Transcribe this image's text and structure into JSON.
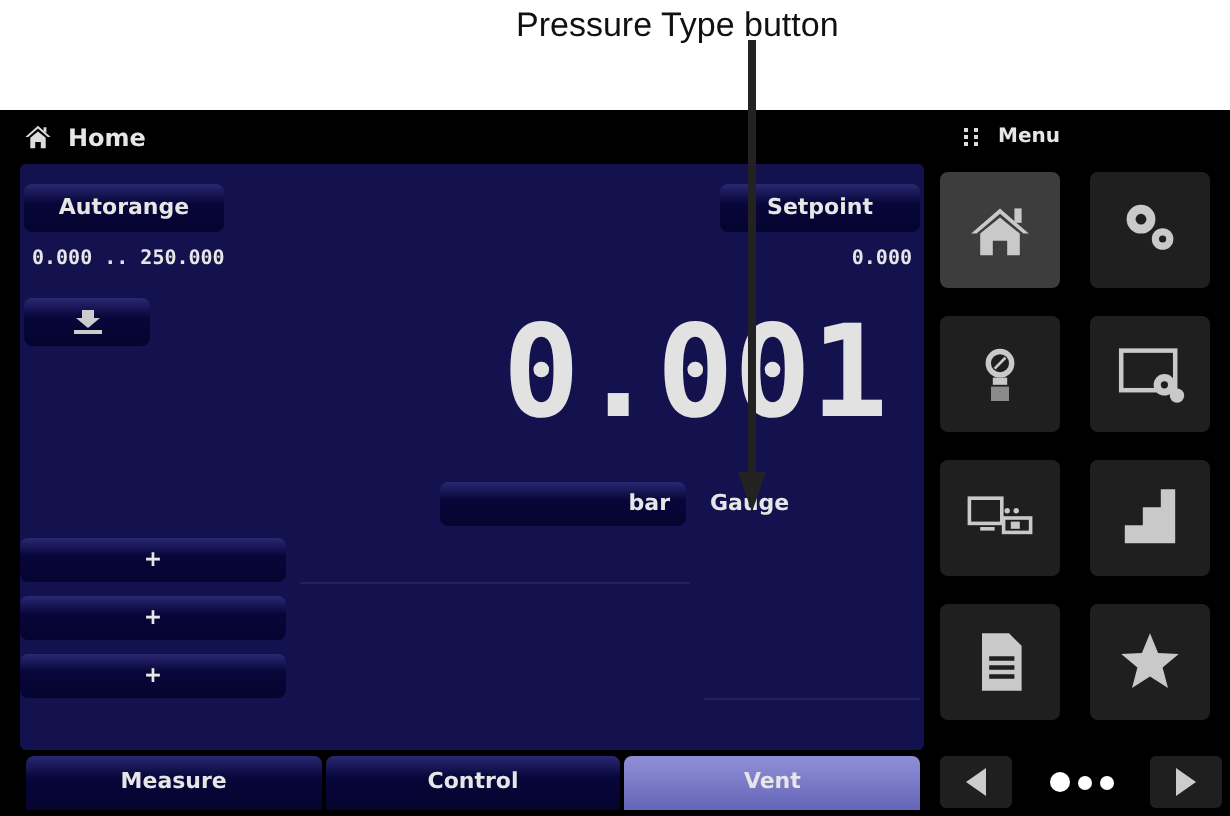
{
  "annotation": {
    "label": "Pressure Type button"
  },
  "title_bar": {
    "title": "Home"
  },
  "menu_header": {
    "title": "Menu"
  },
  "panel": {
    "autorange_button": "Autorange",
    "range": "0.000 .. 250.000",
    "setpoint_button": "Setpoint",
    "setpoint_value": "0.000",
    "reading": "0.001",
    "unit": "bar",
    "pressure_type": "Gauge",
    "plus_buttons": [
      "+",
      "+",
      "+"
    ]
  },
  "tabs": [
    {
      "label": "Measure",
      "selected": false
    },
    {
      "label": "Control",
      "selected": false
    },
    {
      "label": "Vent",
      "selected": true
    }
  ],
  "menu_tiles": [
    {
      "kind": "home",
      "selected": true
    },
    {
      "kind": "gears",
      "selected": false
    },
    {
      "kind": "sensor",
      "selected": false
    },
    {
      "kind": "display-settings",
      "selected": false
    },
    {
      "kind": "remote",
      "selected": false
    },
    {
      "kind": "steps",
      "selected": false
    },
    {
      "kind": "document",
      "selected": false
    },
    {
      "kind": "star",
      "selected": false
    }
  ],
  "pager": [
    {
      "selected": true
    },
    {
      "selected": false
    },
    {
      "selected": false
    }
  ]
}
